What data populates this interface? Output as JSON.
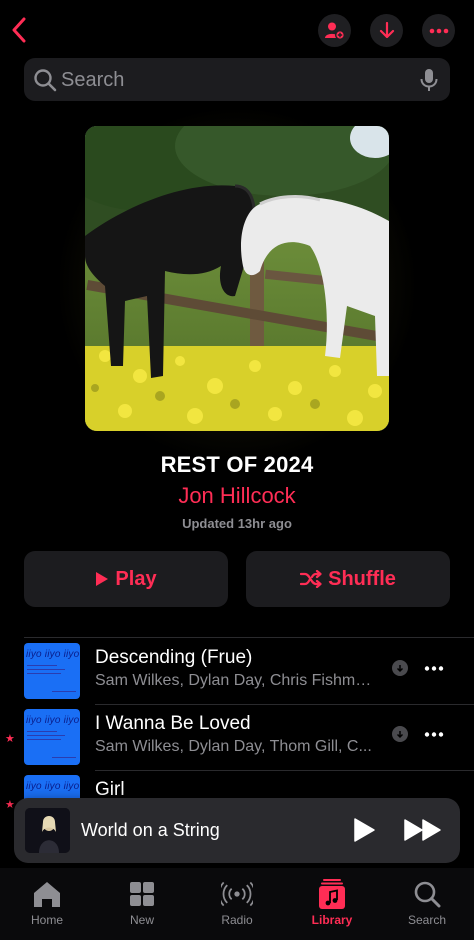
{
  "header": {
    "back_icon": "chevron-left-icon",
    "actions": [
      "add-person-icon",
      "download-icon",
      "more-icon"
    ]
  },
  "search": {
    "placeholder": "Search",
    "icon": "search-icon",
    "mic_icon": "microphone-icon"
  },
  "playlist": {
    "title": "REST OF 2024",
    "curator": "Jon Hillcock",
    "updated": "Updated 13hr ago",
    "play_label": "Play",
    "shuffle_label": "Shuffle"
  },
  "tracks": [
    {
      "name": "Descending (Frue)",
      "artists": "Sam Wilkes, Dylan Day, Chris Fishma...",
      "starred": false,
      "art_text": "iiyo iiyo iiyo"
    },
    {
      "name": "I Wanna Be Loved",
      "artists": "Sam Wilkes, Dylan Day, Thom Gill, C...",
      "starred": true,
      "art_text": "iiyo iiyo iiyo"
    },
    {
      "name": "Girl",
      "artists": "",
      "starred": true,
      "art_text": "iiyo iiyo iiyo"
    }
  ],
  "now_playing": {
    "title": "World on a String"
  },
  "tabs": [
    {
      "label": "Home",
      "icon": "home-icon",
      "active": false
    },
    {
      "label": "New",
      "icon": "grid-icon",
      "active": false
    },
    {
      "label": "Radio",
      "icon": "radio-waves-icon",
      "active": false
    },
    {
      "label": "Library",
      "icon": "music-library-icon",
      "active": true
    },
    {
      "label": "Search",
      "icon": "search-icon",
      "active": false
    }
  ],
  "colors": {
    "accent": "#ff2d55",
    "background": "#000000",
    "card": "#1c1c1f",
    "secondary_text": "#8e8e93"
  }
}
